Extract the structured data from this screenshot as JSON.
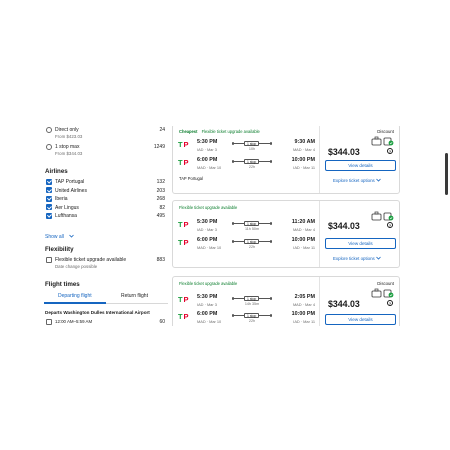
{
  "sidebar": {
    "stops": [
      {
        "label": "Direct only",
        "sub": "From $423.03",
        "count": "24"
      },
      {
        "label": "1 stop max",
        "sub": "From $344.03",
        "count": "1249"
      }
    ],
    "airlines_title": "Airlines",
    "airlines": [
      {
        "label": "TAP Portugal",
        "count": "132"
      },
      {
        "label": "United Airlines",
        "count": "203"
      },
      {
        "label": "Iberia",
        "count": "268"
      },
      {
        "label": "Aer Lingus",
        "count": "82"
      },
      {
        "label": "Lufthansa",
        "count": "495"
      }
    ],
    "show_all": "Show all",
    "flexibility_title": "Flexibility",
    "flex_option": {
      "label": "Flexible ticket upgrade available",
      "sub": "Date change possible",
      "count": "883"
    },
    "flight_times_title": "Flight times",
    "tabs": [
      "Departing flight",
      "Return flight"
    ],
    "departs_label": "Departs Washington Dulles International Airport",
    "time_option": {
      "label": "12:00 AM–5:59 AM",
      "count": "60"
    }
  },
  "results": [
    {
      "badges": {
        "cheapest": "Cheapest",
        "flex": "Flexible ticket upgrade available"
      },
      "legs": [
        {
          "dep_time": "5:30 PM",
          "dep_code": "IAD · Mar 3",
          "stops": "1 stop",
          "duration": "10h",
          "arr_time": "9:30 AM",
          "arr_code": "MAD · Mar 4"
        },
        {
          "dep_time": "6:00 PM",
          "dep_code": "MAD · Mar 10",
          "stops": "1 stop",
          "duration": "22h",
          "arr_time": "10:00 PM",
          "arr_code": "IAD · Mar 11"
        }
      ],
      "carrier": "TAP Portugal",
      "discount": "Discount",
      "price": "$344.03",
      "view_details": "View details",
      "explore": "Explore ticket options"
    },
    {
      "badges": {
        "cheapest": "",
        "flex": "Flexible ticket upgrade available"
      },
      "legs": [
        {
          "dep_time": "5:30 PM",
          "dep_code": "IAD · Mar 3",
          "stops": "1 stop",
          "duration": "11h 50m",
          "arr_time": "11:20 AM",
          "arr_code": "MAD · Mar 4"
        },
        {
          "dep_time": "6:00 PM",
          "dep_code": "MAD · Mar 10",
          "stops": "1 stop",
          "duration": "22h",
          "arr_time": "10:00 PM",
          "arr_code": "IAD · Mar 11"
        }
      ],
      "carrier": "",
      "discount": "",
      "price": "$344.03",
      "view_details": "View details",
      "explore": "Explore ticket options"
    },
    {
      "badges": {
        "cheapest": "",
        "flex": "Flexible ticket upgrade available"
      },
      "legs": [
        {
          "dep_time": "5:30 PM",
          "dep_code": "IAD · Mar 3",
          "stops": "1 stop",
          "duration": "14h 35m",
          "arr_time": "2:05 PM",
          "arr_code": "MAD · Mar 4"
        },
        {
          "dep_time": "6:00 PM",
          "dep_code": "MAD · Mar 10",
          "stops": "1 stop",
          "duration": "22h",
          "arr_time": "10:00 PM",
          "arr_code": "IAD · Mar 11"
        }
      ],
      "carrier": "",
      "discount": "Discount",
      "price": "$344.03",
      "view_details": "View details",
      "explore": ""
    }
  ],
  "colors": {
    "accent": "#1565c0",
    "flex_green": "#0a7d2c",
    "tap_red": "#e4002b",
    "tap_green": "#1a9e3f"
  },
  "icons": [
    "radio-icon",
    "checkbox-icon",
    "chevron-down-icon",
    "tap-logo-icon",
    "carry-on-bag-icon",
    "checked-bag-icon",
    "info-icon"
  ]
}
